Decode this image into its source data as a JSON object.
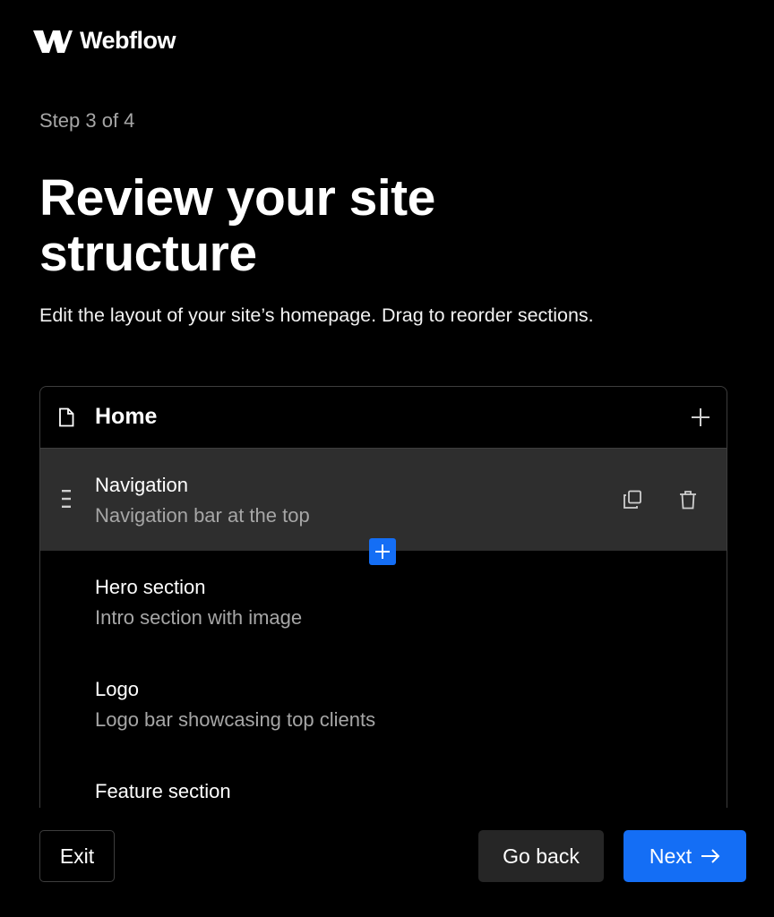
{
  "brand": {
    "name": "Webflow",
    "icon": "webflow-logo-icon"
  },
  "step": {
    "label": "Step 3 of 4"
  },
  "title": "Review your site structure",
  "subtitle": "Edit the layout of your site’s homepage. Drag to reorder sections.",
  "page": {
    "name": "Home",
    "icon": "page-icon",
    "add_icon": "plus-icon"
  },
  "sections": [
    {
      "name": "Navigation",
      "description": "Navigation bar at the top",
      "active": true
    },
    {
      "name": "Hero section",
      "description": "Intro section with image"
    },
    {
      "name": "Logo",
      "description": "Logo bar showcasing top clients"
    },
    {
      "name": "Feature section",
      "description": ""
    }
  ],
  "section_actions": {
    "duplicate_icon": "duplicate-icon",
    "delete_icon": "trash-icon",
    "drag_icon": "drag-handle-icon",
    "insert_icon": "plus-icon"
  },
  "footer": {
    "exit_label": "Exit",
    "back_label": "Go back",
    "next_label": "Next",
    "next_icon": "arrow-right-icon"
  },
  "colors": {
    "background": "#000000",
    "accent": "#146ef5",
    "active_row": "#2e2e2e",
    "muted_text": "#a6a6a6"
  }
}
